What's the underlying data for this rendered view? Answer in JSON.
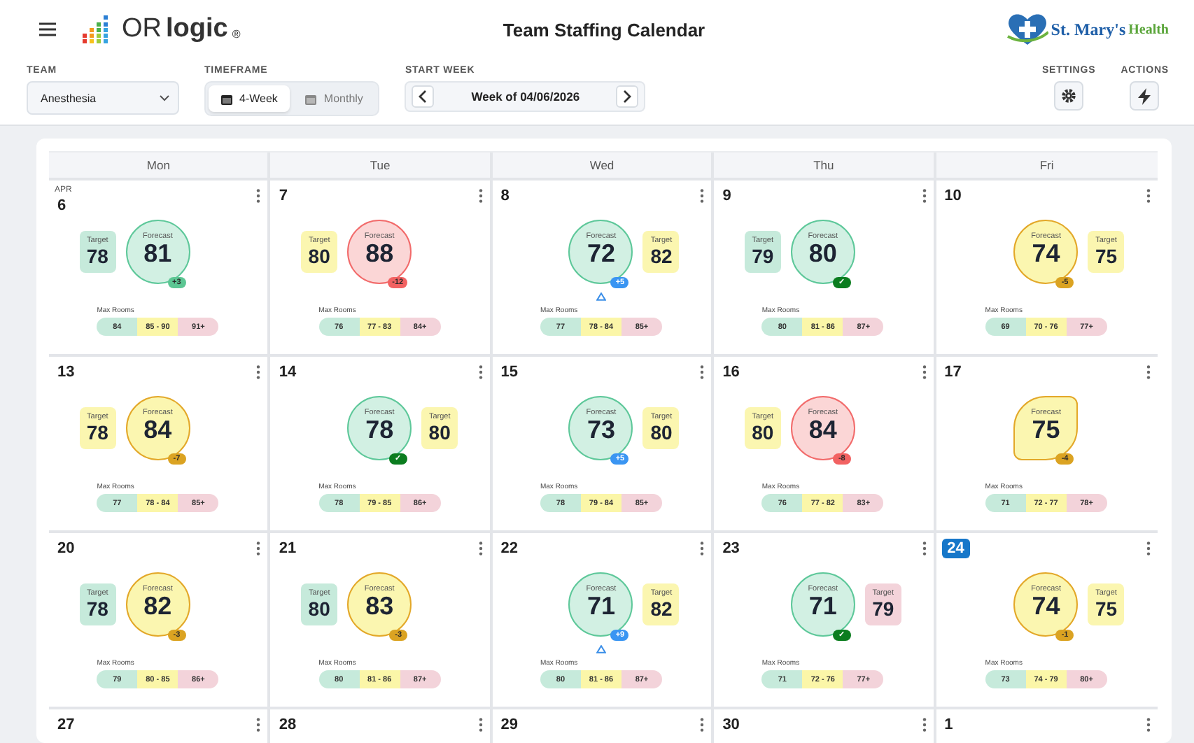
{
  "header": {
    "logo": {
      "prefix": "OR",
      "name": "logic",
      "mark": "®"
    },
    "title": "Team Staffing Calendar",
    "partner_logo": {
      "name": "St. Mary's",
      "suffix": "Health"
    }
  },
  "toolbar": {
    "team": {
      "label": "TEAM",
      "value": "Anesthesia"
    },
    "timeframe": {
      "label": "TIMEFRAME",
      "options": [
        {
          "label": "4-Week",
          "selected": true
        },
        {
          "label": "Monthly",
          "selected": false
        }
      ]
    },
    "start_week": {
      "label": "START WEEK",
      "value": "Week of 04/06/2026"
    },
    "settings": {
      "label": "SETTINGS"
    },
    "actions": {
      "label": "ACTIONS"
    }
  },
  "calendar": {
    "weekdays": [
      "Mon",
      "Tue",
      "Wed",
      "Thu",
      "Fri"
    ],
    "weeks": [
      [
        {
          "date": "6",
          "month": "APR",
          "today": false,
          "metrics": [
            {
              "kind": "target",
              "label": "Target",
              "value": "78",
              "color": "#c6eadb"
            },
            {
              "kind": "forecast",
              "label": "Forecast",
              "value": "81",
              "color": "#5ec89a",
              "badge": {
                "text": "+3",
                "color": "#5cc693"
              },
              "alert": false
            }
          ],
          "rooms": {
            "label": "Max Rooms",
            "low": "84",
            "mid": "85 - 90",
            "high": "91+"
          }
        },
        {
          "date": "7",
          "today": false,
          "metrics": [
            {
              "kind": "target",
              "label": "Target",
              "value": "80",
              "color": "#fbf6b0"
            },
            {
              "kind": "forecast",
              "label": "Forecast",
              "value": "88",
              "color": "#f26b6b",
              "badge": {
                "text": "-12",
                "color": "#f26262"
              },
              "alert": false
            }
          ],
          "rooms": {
            "label": "Max Rooms",
            "low": "76",
            "mid": "77 - 83",
            "high": "84+"
          }
        },
        {
          "date": "8",
          "today": false,
          "metrics": [
            {
              "kind": "forecast",
              "label": "Forecast",
              "value": "72",
              "color": "#5ec89a",
              "badge": {
                "text": "+5",
                "color": "#3a95f2"
              },
              "alert": true
            },
            {
              "kind": "target",
              "label": "Target",
              "value": "82",
              "color": "#fbf6b0"
            }
          ],
          "rooms": {
            "label": "Max Rooms",
            "low": "77",
            "mid": "78 - 84",
            "high": "85+"
          }
        },
        {
          "date": "9",
          "today": false,
          "metrics": [
            {
              "kind": "target",
              "label": "Target",
              "value": "79",
              "color": "#c6eadb"
            },
            {
              "kind": "forecast",
              "label": "Forecast",
              "value": "80",
              "color": "#5ec89a",
              "badge": {
                "text": "✓",
                "color": "#0b7d1f"
              },
              "alert": false
            }
          ],
          "rooms": {
            "label": "Max Rooms",
            "low": "80",
            "mid": "81 - 86",
            "high": "87+"
          }
        },
        {
          "date": "10",
          "today": false,
          "metrics": [
            {
              "kind": "forecast",
              "label": "Forecast",
              "value": "74",
              "color": "#e3a829",
              "badge": {
                "text": "-5",
                "color": "#dba322"
              },
              "alert": false
            },
            {
              "kind": "target",
              "label": "Target",
              "value": "75",
              "color": "#fbf6b0"
            }
          ],
          "rooms": {
            "label": "Max Rooms",
            "low": "69",
            "mid": "70 - 76",
            "high": "77+"
          }
        }
      ],
      [
        {
          "date": "13",
          "today": false,
          "metrics": [
            {
              "kind": "target",
              "label": "Target",
              "value": "78",
              "color": "#fbf6b0"
            },
            {
              "kind": "forecast",
              "label": "Forecast",
              "value": "84",
              "color": "#e3a829",
              "badge": {
                "text": "-7",
                "color": "#dba322"
              },
              "alert": false
            }
          ],
          "rooms": {
            "label": "Max Rooms",
            "low": "77",
            "mid": "78 - 84",
            "high": "85+"
          }
        },
        {
          "date": "14",
          "today": false,
          "metrics": [
            {
              "kind": "forecast",
              "label": "Forecast",
              "value": "78",
              "color": "#5ec89a",
              "badge": {
                "text": "✓",
                "color": "#0b7d1f"
              },
              "alert": false
            },
            {
              "kind": "target",
              "label": "Target",
              "value": "80",
              "color": "#fbf6b0"
            }
          ],
          "rooms": {
            "label": "Max Rooms",
            "low": "78",
            "mid": "79 - 85",
            "high": "86+"
          }
        },
        {
          "date": "15",
          "today": false,
          "metrics": [
            {
              "kind": "forecast",
              "label": "Forecast",
              "value": "73",
              "color": "#5ec89a",
              "badge": {
                "text": "+5",
                "color": "#3a95f2"
              },
              "alert": false
            },
            {
              "kind": "target",
              "label": "Target",
              "value": "80",
              "color": "#fbf6b0"
            }
          ],
          "rooms": {
            "label": "Max Rooms",
            "low": "78",
            "mid": "79 - 84",
            "high": "85+"
          }
        },
        {
          "date": "16",
          "today": false,
          "metrics": [
            {
              "kind": "target",
              "label": "Target",
              "value": "80",
              "color": "#fbf6b0"
            },
            {
              "kind": "forecast",
              "label": "Forecast",
              "value": "84",
              "color": "#f26b6b",
              "badge": {
                "text": "-8",
                "color": "#f26262"
              },
              "alert": false
            }
          ],
          "rooms": {
            "label": "Max Rooms",
            "low": "76",
            "mid": "77 - 82",
            "high": "83+"
          }
        },
        {
          "date": "17",
          "today": false,
          "metrics": [
            {
              "kind": "leaf",
              "label": "Forecast",
              "value": "75",
              "color": "#e3a829",
              "badge": {
                "text": "-4",
                "color": "#dba322"
              },
              "alert": false
            }
          ],
          "rooms": {
            "label": "Max Rooms",
            "low": "71",
            "mid": "72 - 77",
            "high": "78+"
          }
        }
      ],
      [
        {
          "date": "20",
          "today": false,
          "metrics": [
            {
              "kind": "target",
              "label": "Target",
              "value": "78",
              "color": "#c6eadb"
            },
            {
              "kind": "forecast",
              "label": "Forecast",
              "value": "82",
              "color": "#e3a829",
              "badge": {
                "text": "-3",
                "color": "#dba322"
              },
              "alert": false
            }
          ],
          "rooms": {
            "label": "Max Rooms",
            "low": "79",
            "mid": "80 - 85",
            "high": "86+"
          }
        },
        {
          "date": "21",
          "today": false,
          "metrics": [
            {
              "kind": "target",
              "label": "Target",
              "value": "80",
              "color": "#c6eadb"
            },
            {
              "kind": "forecast",
              "label": "Forecast",
              "value": "83",
              "color": "#e3a829",
              "badge": {
                "text": "-3",
                "color": "#dba322"
              },
              "alert": false
            }
          ],
          "rooms": {
            "label": "Max Rooms",
            "low": "80",
            "mid": "81 - 86",
            "high": "87+"
          }
        },
        {
          "date": "22",
          "today": false,
          "metrics": [
            {
              "kind": "forecast",
              "label": "Forecast",
              "value": "71",
              "color": "#5ec89a",
              "badge": {
                "text": "+9",
                "color": "#3a95f2"
              },
              "alert": true
            },
            {
              "kind": "target",
              "label": "Target",
              "value": "82",
              "color": "#fbf6b0"
            }
          ],
          "rooms": {
            "label": "Max Rooms",
            "low": "80",
            "mid": "81 - 86",
            "high": "87+"
          }
        },
        {
          "date": "23",
          "today": false,
          "metrics": [
            {
              "kind": "forecast",
              "label": "Forecast",
              "value": "71",
              "color": "#5ec89a",
              "badge": {
                "text": "✓",
                "color": "#0b7d1f"
              },
              "alert": false
            },
            {
              "kind": "target",
              "label": "Target",
              "value": "79",
              "color": "#f3d3da"
            }
          ],
          "rooms": {
            "label": "Max Rooms",
            "low": "71",
            "mid": "72 - 76",
            "high": "77+"
          }
        },
        {
          "date": "24",
          "today": true,
          "metrics": [
            {
              "kind": "forecast",
              "label": "Forecast",
              "value": "74",
              "color": "#e3a829",
              "badge": {
                "text": "-1",
                "color": "#dba322"
              },
              "alert": false
            },
            {
              "kind": "target",
              "label": "Target",
              "value": "75",
              "color": "#fbf6b0"
            }
          ],
          "rooms": {
            "label": "Max Rooms",
            "low": "73",
            "mid": "74 - 79",
            "high": "80+"
          }
        }
      ],
      [
        {
          "date": "27",
          "today": false
        },
        {
          "date": "28",
          "today": false
        },
        {
          "date": "29",
          "today": false
        },
        {
          "date": "30",
          "today": false
        },
        {
          "date": "1",
          "today": false
        }
      ]
    ]
  }
}
